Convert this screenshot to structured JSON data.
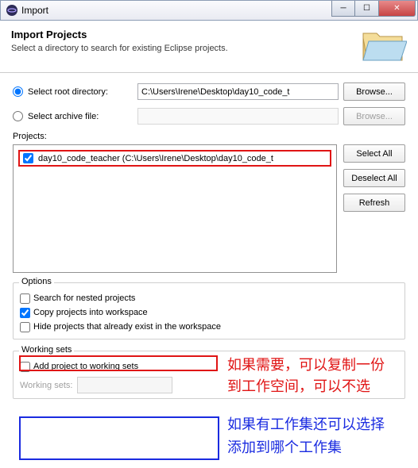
{
  "window": {
    "title": "Import"
  },
  "header": {
    "title": "Import Projects",
    "subtitle": "Select a directory to search for existing Eclipse projects."
  },
  "source": {
    "root_label": "Select root directory:",
    "root_path": "C:\\Users\\Irene\\Desktop\\day10_code_t",
    "archive_label": "Select archive file:",
    "browse": "Browse..."
  },
  "projects": {
    "label": "Projects:",
    "items": [
      {
        "name": "day10_code_teacher (C:\\Users\\Irene\\Desktop\\day10_code_t",
        "checked": true
      }
    ]
  },
  "buttons": {
    "select_all": "Select All",
    "deselect_all": "Deselect All",
    "refresh": "Refresh"
  },
  "options": {
    "group": "Options",
    "search_nested": "Search for nested projects",
    "copy_into_ws": "Copy projects into workspace",
    "hide_existing": "Hide projects that already exist in the workspace"
  },
  "working_sets": {
    "group": "Working sets",
    "add_label": "Add project to working sets",
    "ws_label": "Working sets:"
  },
  "annotations": {
    "red1": "如果需要，可以复制一份",
    "red2": "到工作空间，可以不选",
    "blue1": "如果有工作集还可以选择",
    "blue2": "添加到哪个工作集"
  }
}
